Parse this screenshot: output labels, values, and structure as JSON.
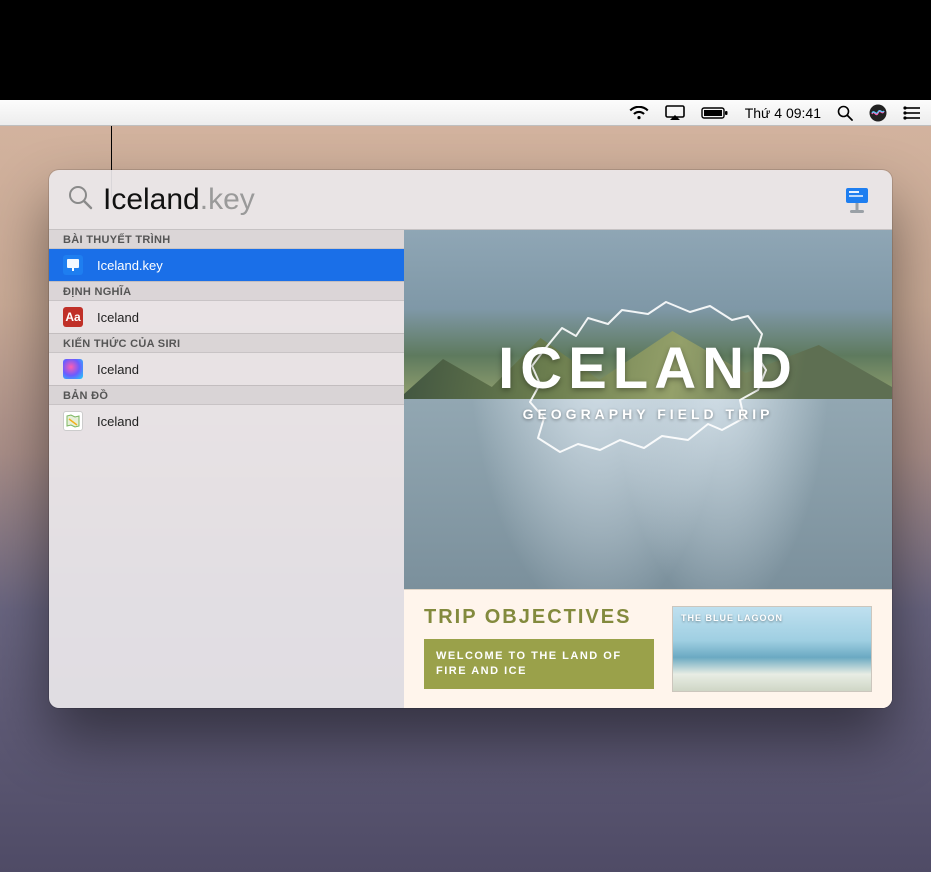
{
  "menubar": {
    "datetime": "Thứ 4 09:41"
  },
  "spotlight": {
    "query_base": "Iceland",
    "query_ext": ".key",
    "categories": [
      {
        "label": "BÀI THUYẾT TRÌNH",
        "items": [
          {
            "label": "Iceland.key",
            "icon": "keynote",
            "selected": true
          }
        ]
      },
      {
        "label": "ĐỊNH NGHĨA",
        "items": [
          {
            "label": "Iceland",
            "icon": "definition"
          }
        ]
      },
      {
        "label": "KIẾN THỨC CỦA SIRI",
        "items": [
          {
            "label": "Iceland",
            "icon": "siri"
          }
        ]
      },
      {
        "label": "BẢN ĐỒ",
        "items": [
          {
            "label": "Iceland",
            "icon": "maps"
          }
        ]
      }
    ]
  },
  "preview": {
    "slide1": {
      "title": "ICELAND",
      "subtitle": "GEOGRAPHY FIELD TRIP"
    },
    "slide2": {
      "heading": "TRIP OBJECTIVES",
      "banner": "WELCOME TO THE LAND OF FIRE AND ICE",
      "thumb_caption": "THE BLUE LAGOON"
    }
  }
}
